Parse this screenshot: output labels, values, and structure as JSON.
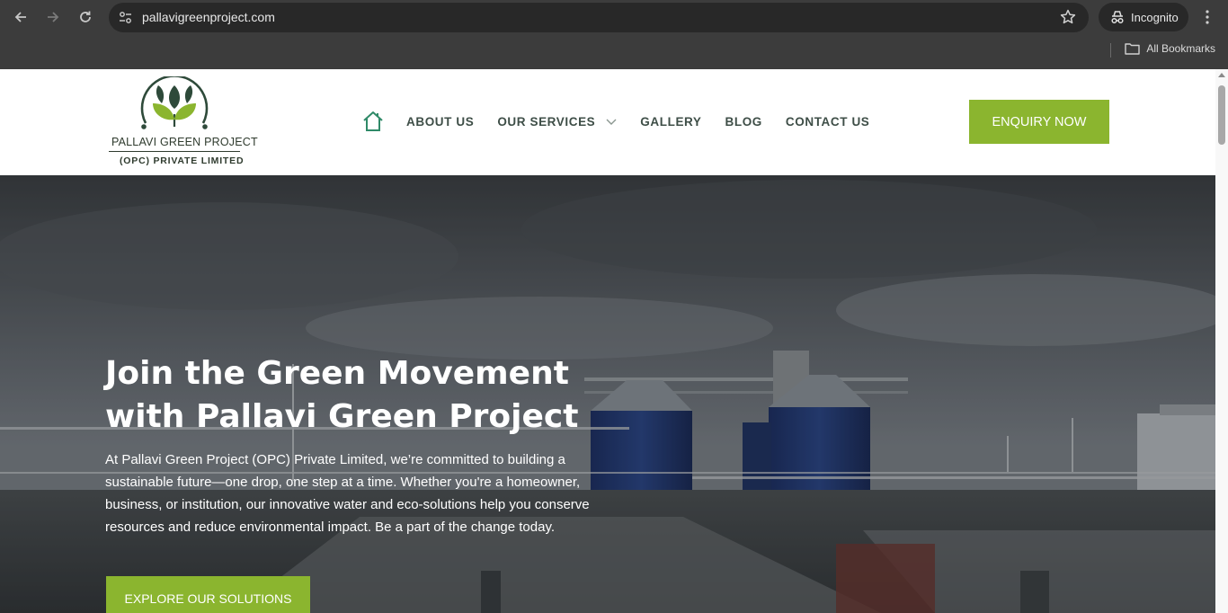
{
  "browser": {
    "url": "pallavigreenproject.com",
    "incognito_label": "Incognito",
    "bookmarks_label": "All Bookmarks",
    "icons": [
      "back-arrow-icon",
      "forward-arrow-icon",
      "reload-icon",
      "site-info-icon",
      "bookmark-star-icon",
      "incognito-icon",
      "more-menu-icon",
      "folder-icon"
    ]
  },
  "header": {
    "logo": {
      "line1": "PALLAVI GREEN PROJECT",
      "line2": "(OPC) PRIVATE LIMITED"
    },
    "nav": [
      {
        "label": "ABOUT US"
      },
      {
        "label": "OUR SERVICES",
        "has_dropdown": true
      },
      {
        "label": "GALLERY"
      },
      {
        "label": "BLOG"
      },
      {
        "label": "CONTACT US"
      }
    ],
    "cta_label": "ENQUIRY NOW"
  },
  "hero": {
    "title_line1": "Join the Green Movement",
    "title_line2": "with Pallavi Green Project",
    "text": "At Pallavi Green Project (OPC) Private Limited, we’re committed to building a sustainable future—one drop, one step at a time. Whether you're a homeowner, business, or institution, our innovative water and eco-solutions help you conserve resources and reduce environmental impact. Be a part of the change today.",
    "cta_label": "EXPLORE OUR SOLUTIONS"
  },
  "colors": {
    "accent_green": "#8bb52f",
    "logo_dark_green": "#2e4a3a",
    "nav_text": "#3e4e47",
    "chrome_bg": "#3c3c3c"
  }
}
